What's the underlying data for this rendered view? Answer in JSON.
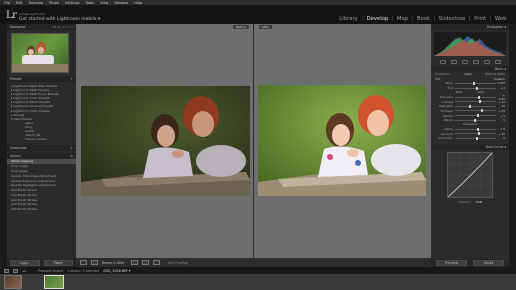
{
  "menubar": [
    "File",
    "Edit",
    "Develop",
    "Photo",
    "Settings",
    "Tools",
    "View",
    "Window",
    "Help"
  ],
  "header": {
    "logo": "Lr",
    "catalog_label": "Adobe Lightroom",
    "get_started": "Get started with Lightroom mobile ▾",
    "modules": [
      "Library",
      "Develop",
      "Map",
      "Book",
      "Slideshow",
      "Print",
      "Web"
    ],
    "active_module": "Develop"
  },
  "left_panel": {
    "navigator": {
      "title": "Navigator",
      "zoom": "FIT  FILL  1:1  3:1 ▾"
    },
    "presets": {
      "title": "Presets",
      "items": [
        "▸ Lightroom B&W Filter Presets",
        "▸ Lightroom B&W Presets",
        "▸ Lightroom B&W Toned Presets",
        "▸ Lightroom Color Presets",
        "▸ Lightroom Effect Presets",
        "▸ Lightroom General Presets",
        "▸ Lightroom Video Presets",
        "▸ Sunset",
        "▾ User Presets"
      ],
      "user_items": [
        "sepia",
        "stroy",
        "winter",
        "search_00",
        "Flower contain"
      ]
    },
    "snapshots_title": "Snapshots",
    "history": {
      "title": "History",
      "items": [
        "White Clipping",
        "Crop Angle",
        "Crop Angle",
        "Update Sharpness Adjustment",
        "Update Exposure Adjustment",
        "Update Highlights Adjustment",
        "Add Brush Stroke",
        "Add Brush Stroke",
        "Add Brush Stroke",
        "Add Brush Stroke",
        "Add Brush Stroke"
      ],
      "selected_index": 0
    },
    "copy_label": "Copy...",
    "paste_label": "Paste"
  },
  "center": {
    "before_label": "Before",
    "after_label": "After"
  },
  "toolbar": {
    "mode_label": "Before & After :",
    "proofing_label": "Soft Proofing"
  },
  "right_panel": {
    "histogram_title": "Histogram ◂",
    "basic": {
      "title": "Basic ◂",
      "treatment": [
        "Treatment :",
        "Color",
        "Black & White"
      ],
      "wb": "WB :",
      "wb_value": "Custom",
      "tone_label": "Tone",
      "tone_auto": "Auto",
      "presence_label": "Presence",
      "rows": [
        {
          "label": "Temp",
          "value": "4,700",
          "pos": 0.45
        },
        {
          "label": "Tint",
          "value": "+ 4",
          "pos": 0.52
        },
        {
          "label": "Exposure",
          "value": "+ 0.20",
          "pos": 0.55
        },
        {
          "label": "Contrast",
          "value": "+ 12",
          "pos": 0.58
        },
        {
          "label": "Highlights",
          "value": "- 36",
          "pos": 0.35
        },
        {
          "label": "Shadows",
          "value": "+ 29",
          "pos": 0.64
        },
        {
          "label": "Whites",
          "value": "+ 5",
          "pos": 0.53
        },
        {
          "label": "Blacks",
          "value": "- 5",
          "pos": 0.47
        },
        {
          "label": "Clarity",
          "value": "+ 8",
          "pos": 0.54
        },
        {
          "label": "Vibrance",
          "value": "+ 10",
          "pos": 0.55
        },
        {
          "label": "Saturation",
          "value": "0",
          "pos": 0.5
        }
      ]
    },
    "tone_curve": {
      "title": "Tone Curve ◂",
      "channel": "Channel :",
      "channel_value": "RGB"
    },
    "previous_label": "Previous",
    "reset_label": "Reset"
  },
  "filmstrip": {
    "source": "Previous Import",
    "count": "1 photo / 1 selected",
    "filename": "/DSC_5026.NEF ▾"
  }
}
